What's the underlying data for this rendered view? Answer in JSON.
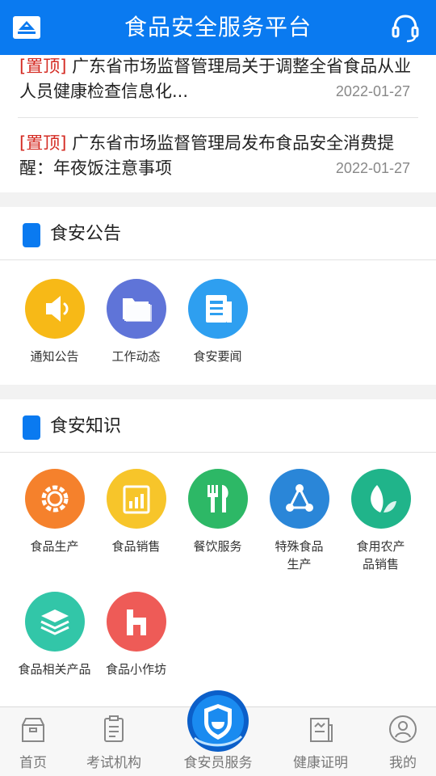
{
  "header": {
    "title": "食品安全服务平台",
    "accent_color": "#0a7af0",
    "left_icon": "platform-logo-icon",
    "right_icon": "headset-icon"
  },
  "news": [
    {
      "tag": "[置顶]",
      "text": "广东省市场监督管理局关于调整全省食品从业人员健康检查信息化...",
      "date": "2022-01-27"
    },
    {
      "tag": "[置顶]",
      "text": "广东省市场监督管理局发布食品安全消费提醒：年夜饭注意事项",
      "date": "2022-01-27"
    }
  ],
  "sections": {
    "announcements": {
      "title": "食安公告",
      "items": [
        {
          "label": "通知公告",
          "icon": "megaphone-icon",
          "color": "#f7b917"
        },
        {
          "label": "工作动态",
          "icon": "folder-icon",
          "color": "#5f74d8"
        },
        {
          "label": "食安要闻",
          "icon": "newspaper-icon",
          "color": "#2e9ff0"
        }
      ]
    },
    "knowledge": {
      "title": "食安知识",
      "items": [
        {
          "label": "食品生产",
          "icon": "gear-icon",
          "color": "#f5812c"
        },
        {
          "label": "食品销售",
          "icon": "sales-chart-icon",
          "color": "#f7c52a"
        },
        {
          "label": "餐饮服务",
          "icon": "fork-knife-icon",
          "color": "#2db866"
        },
        {
          "label": "特殊食品生产",
          "icon": "molecule-icon",
          "color": "#2a86d8"
        },
        {
          "label": "食用农产品销售",
          "icon": "leaf-icon",
          "color": "#20b48a"
        },
        {
          "label": "食品相关产品",
          "icon": "layers-icon",
          "color": "#32c6a8"
        },
        {
          "label": "食品小作坊",
          "icon": "workshop-icon",
          "color": "#ee5b57"
        }
      ]
    }
  },
  "bottom_nav": [
    {
      "label": "首页",
      "icon": "home-box-icon"
    },
    {
      "label": "考试机构",
      "icon": "clipboard-icon"
    },
    {
      "label": "食安员服务",
      "icon": "food-safety-emblem-icon"
    },
    {
      "label": "健康证明",
      "icon": "certificate-icon"
    },
    {
      "label": "我的",
      "icon": "user-icon"
    }
  ]
}
